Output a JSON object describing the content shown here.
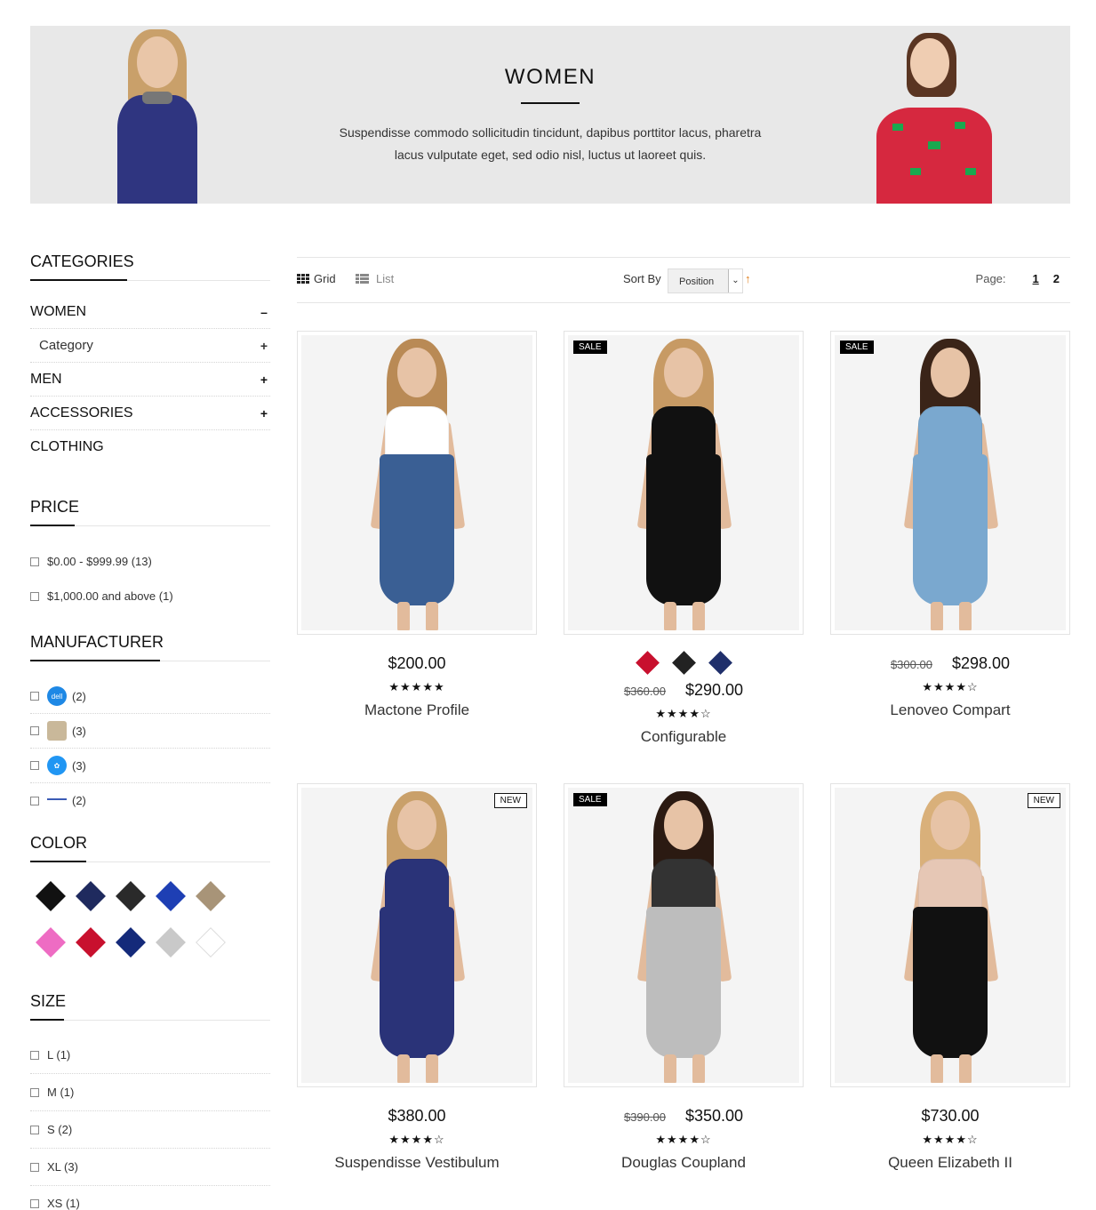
{
  "banner": {
    "title": "WOMEN",
    "text": "Suspendisse commodo sollicitudin tincidunt, dapibus porttitor lacus, pharetra lacus vulputate eget, sed odio nisl, luctus ut laoreet quis."
  },
  "sidebar": {
    "categories": {
      "title": "CATEGORIES",
      "items": [
        {
          "label": "WOMEN",
          "toggle": "–"
        },
        {
          "label": "Category",
          "toggle": "+"
        },
        {
          "label": "MEN",
          "toggle": "+"
        },
        {
          "label": "ACCESSORIES",
          "toggle": "+"
        },
        {
          "label": "CLOTHING",
          "toggle": ""
        }
      ]
    },
    "price": {
      "title": "PRICE",
      "items": [
        {
          "label": "$0.00 - $999.99 (13)"
        },
        {
          "label": "$1,000.00 and above (1)"
        }
      ]
    },
    "manufacturer": {
      "title": "MANUFACTURER",
      "items": [
        {
          "count": "(2)",
          "logo_color": "#1e88e5",
          "logo_text": "dell"
        },
        {
          "count": "(3)",
          "logo_color": "#c9b89a",
          "logo_text": ""
        },
        {
          "count": "(3)",
          "logo_color": "#2196f3",
          "logo_text": ""
        },
        {
          "count": "(2)",
          "logo_color": "#3b5bb5",
          "logo_text": ""
        }
      ]
    },
    "color": {
      "title": "COLOR",
      "swatches": [
        "#111111",
        "#1f2a5e",
        "#2a2a2a",
        "#1e3fb4",
        "#a89478",
        "#ee6cc3",
        "#c8102e",
        "#142a7a",
        "#c9c9c9",
        "#ffffff"
      ]
    },
    "size": {
      "title": "SIZE",
      "items": [
        {
          "label": "L (1)"
        },
        {
          "label": "M (1)"
        },
        {
          "label": "S (2)"
        },
        {
          "label": "XL (3)"
        },
        {
          "label": "XS (1)"
        }
      ]
    }
  },
  "toolbar": {
    "grid_label": "Grid",
    "list_label": "List",
    "sort_by_label": "Sort By",
    "sort_value": "Position",
    "sort_direction_icon": "↑",
    "page_label": "Page:",
    "pages": [
      "1",
      "2"
    ],
    "current_page": "1"
  },
  "products": [
    {
      "name": "Mactone Profile",
      "price": "$200.00",
      "old_price": "",
      "rating": "★★★★★",
      "badge": "",
      "colors": [],
      "dress": "#3a5f94",
      "top": "#ffffff",
      "hair": "#b98a55"
    },
    {
      "name": "Configurable",
      "price": "$290.00",
      "old_price": "$360.00",
      "rating": "★★★★☆",
      "badge": "SALE",
      "colors": [
        "#c8102e",
        "#222222",
        "#1f2f6b"
      ],
      "dress": "#111111",
      "top": "#111111",
      "hair": "#c79a64"
    },
    {
      "name": "Lenoveo Compart",
      "price": "$298.00",
      "old_price": "$300.00",
      "rating": "★★★★☆",
      "badge": "SALE",
      "colors": [],
      "dress": "#7aa8cf",
      "top": "#7aa8cf",
      "hair": "#3a2418"
    },
    {
      "name": "Suspendisse Vestibulum",
      "price": "$380.00",
      "old_price": "",
      "rating": "★★★★☆",
      "badge": "NEW",
      "colors": [],
      "dress": "#2a3378",
      "top": "#2a3378",
      "hair": "#c9a06a"
    },
    {
      "name": "Douglas Coupland",
      "price": "$350.00",
      "old_price": "$390.00",
      "rating": "★★★★☆",
      "badge": "SALE",
      "colors": [],
      "dress": "#bdbdbd",
      "top": "#333333",
      "hair": "#2b1a12"
    },
    {
      "name": "Queen Elizabeth II",
      "price": "$730.00",
      "old_price": "",
      "rating": "★★★★☆",
      "badge": "NEW",
      "colors": [],
      "dress": "#111111",
      "top": "#e6c7b5",
      "hair": "#d9b07a"
    }
  ]
}
